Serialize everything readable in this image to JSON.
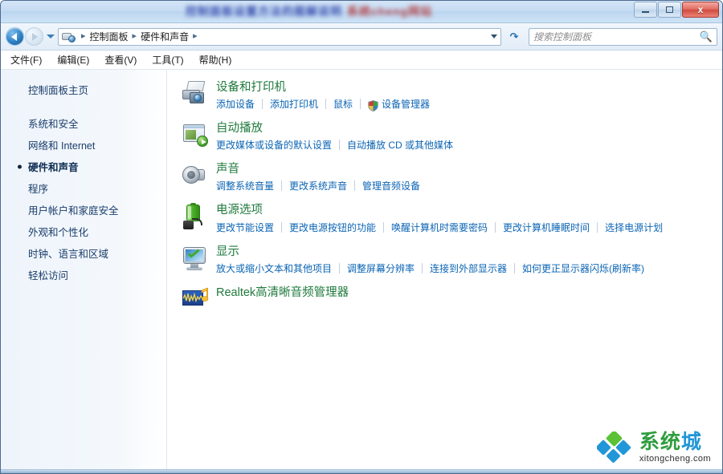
{
  "window": {
    "title_segment_blue": "控制面板设置方法的图解说明",
    "title_segment_red": "系统cheng网站",
    "controls": {
      "minimize": "最小化",
      "maximize": "最大化",
      "close": "x"
    }
  },
  "navbar": {
    "back_label": "后退",
    "forward_label": "前进",
    "history_dropdown_label": "最近浏览的位置",
    "address_icon": "control-panel-icon",
    "breadcrumbs": [
      {
        "label": "控制面板"
      },
      {
        "label": "硬件和声音"
      }
    ],
    "address_dropdown_label": "地址栏下拉",
    "refresh_label": "刷新",
    "search_placeholder": "搜索控制面板",
    "search_value": ""
  },
  "menubar": {
    "items": [
      {
        "label": "文件(F)"
      },
      {
        "label": "编辑(E)"
      },
      {
        "label": "查看(V)"
      },
      {
        "label": "工具(T)"
      },
      {
        "label": "帮助(H)"
      }
    ]
  },
  "sidebar": {
    "home": "控制面板主页",
    "items": [
      {
        "label": "系统和安全",
        "current": false
      },
      {
        "label": "网络和 Internet",
        "current": false
      },
      {
        "label": "硬件和声音",
        "current": true
      },
      {
        "label": "程序",
        "current": false
      },
      {
        "label": "用户帐户和家庭安全",
        "current": false
      },
      {
        "label": "外观和个性化",
        "current": false
      },
      {
        "label": "时钟、语言和区域",
        "current": false
      },
      {
        "label": "轻松访问",
        "current": false
      }
    ]
  },
  "main": {
    "categories": [
      {
        "icon": "devices-and-printers-icon",
        "title": "设备和打印机",
        "links": [
          {
            "label": "添加设备",
            "shield": false
          },
          {
            "label": "添加打印机",
            "shield": false
          },
          {
            "label": "鼠标",
            "shield": false
          },
          {
            "label": "设备管理器",
            "shield": true
          }
        ]
      },
      {
        "icon": "autoplay-icon",
        "title": "自动播放",
        "links": [
          {
            "label": "更改媒体或设备的默认设置",
            "shield": false
          },
          {
            "label": "自动播放 CD 或其他媒体",
            "shield": false
          }
        ]
      },
      {
        "icon": "sound-icon",
        "title": "声音",
        "links": [
          {
            "label": "调整系统音量",
            "shield": false
          },
          {
            "label": "更改系统声音",
            "shield": false
          },
          {
            "label": "管理音频设备",
            "shield": false
          }
        ]
      },
      {
        "icon": "power-options-icon",
        "title": "电源选项",
        "links": [
          {
            "label": "更改节能设置",
            "shield": false
          },
          {
            "label": "更改电源按钮的功能",
            "shield": false
          },
          {
            "label": "唤醒计算机时需要密码",
            "shield": false
          },
          {
            "label": "更改计算机睡眠时间",
            "shield": false
          },
          {
            "label": "选择电源计划",
            "shield": false
          }
        ]
      },
      {
        "icon": "display-icon",
        "title": "显示",
        "links": [
          {
            "label": "放大或缩小文本和其他项目",
            "shield": false
          },
          {
            "label": "调整屏幕分辨率",
            "shield": false
          },
          {
            "label": "连接到外部显示器",
            "shield": false
          },
          {
            "label": "如何更正显示器闪烁(刷新率)",
            "shield": false
          }
        ]
      },
      {
        "icon": "realtek-audio-icon",
        "title": "Realtek高清晰音频管理器",
        "links": []
      }
    ]
  },
  "watermark": {
    "logo": "diamond-logo",
    "name_part1": "系",
    "name_part2": "统",
    "name_part3": "城",
    "domain": "xitongcheng.com"
  },
  "colors": {
    "category_title": "#1f7a3d",
    "link": "#0b64b4",
    "sidebar_text": "#1a3d6b",
    "watermark_green": "#2f9d3f",
    "watermark_blue": "#2196d8"
  }
}
